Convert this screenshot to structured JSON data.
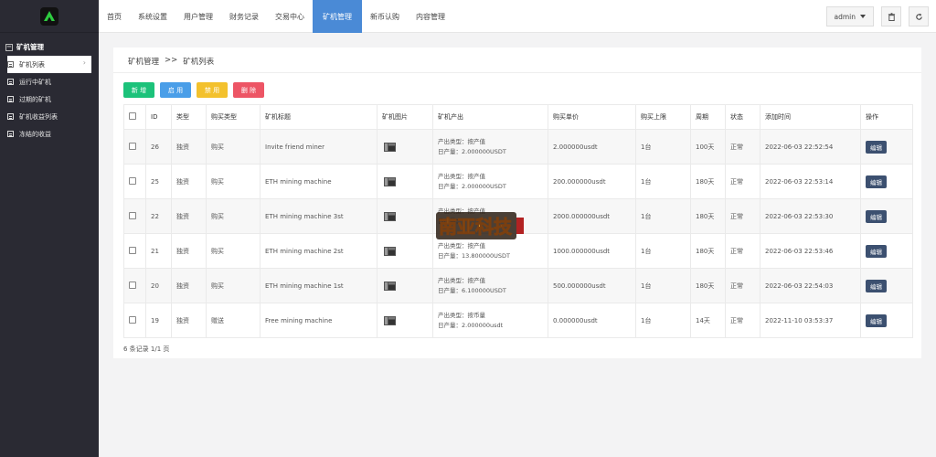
{
  "sidebar": {
    "group_label": "矿机管理",
    "items": [
      {
        "label": "矿机列表",
        "active": true
      },
      {
        "label": "运行中矿机"
      },
      {
        "label": "过期的矿机"
      },
      {
        "label": "矿机收益列表"
      },
      {
        "label": "冻结的收益"
      }
    ]
  },
  "topnav": {
    "items": [
      "首页",
      "系统设置",
      "用户管理",
      "财务记录",
      "交易中心",
      "矿机管理",
      "新币认购",
      "内容管理"
    ],
    "active_index": 5,
    "user": "admin"
  },
  "breadcrumb": {
    "parent": "矿机管理",
    "separator": ">>",
    "current": "矿机列表"
  },
  "toolbar": {
    "add": "新 增",
    "enable": "启 用",
    "disable": "禁 用",
    "delete": "删 除"
  },
  "table": {
    "headers": [
      "ID",
      "类型",
      "购买类型",
      "矿机标题",
      "矿机图片",
      "矿机产出",
      "购买单价",
      "购买上限",
      "周期",
      "状态",
      "添加时间",
      "操作"
    ],
    "rows": [
      {
        "id": "26",
        "type": "独资",
        "buy_type": "购买",
        "buy_color": "green",
        "title": "Invite friend miner",
        "out_type": "产出类型：按产值",
        "out_daily": "日产量：2.000000USDT",
        "price": "2.000000usdt",
        "limit": "1台",
        "cycle": "100天",
        "status": "正常",
        "time": "2022-06-03 22:52:54",
        "action": "编辑"
      },
      {
        "id": "25",
        "type": "独资",
        "buy_type": "购买",
        "buy_color": "green",
        "title": "ETH mining machine",
        "out_type": "产出类型：按产值",
        "out_daily": "日产量：2.000000USDT",
        "price": "200.000000usdt",
        "limit": "1台",
        "cycle": "180天",
        "status": "正常",
        "time": "2022-06-03 22:53:14",
        "action": "编辑"
      },
      {
        "id": "22",
        "type": "独资",
        "buy_type": "购买",
        "buy_color": "green",
        "title": "ETH mining machine 3st",
        "out_type": "产出类型：按产值",
        "out_daily": "日产量：",
        "price": "2000.000000usdt",
        "limit": "1台",
        "cycle": "180天",
        "status": "正常",
        "time": "2022-06-03 22:53:30",
        "action": "编辑"
      },
      {
        "id": "21",
        "type": "独资",
        "buy_type": "购买",
        "buy_color": "green",
        "title": "ETH mining machine 2st",
        "out_type": "产出类型：按产值",
        "out_daily": "日产量：13.800000USDT",
        "price": "1000.000000usdt",
        "limit": "1台",
        "cycle": "180天",
        "status": "正常",
        "time": "2022-06-03 22:53:46",
        "action": "编辑"
      },
      {
        "id": "20",
        "type": "独资",
        "buy_type": "购买",
        "buy_color": "green",
        "title": "ETH mining machine 1st",
        "out_type": "产出类型：按产值",
        "out_daily": "日产量：6.100000USDT",
        "price": "500.000000usdt",
        "limit": "1台",
        "cycle": "180天",
        "status": "正常",
        "time": "2022-06-03 22:54:03",
        "action": "编辑"
      },
      {
        "id": "19",
        "type": "独资",
        "buy_type": "赠送",
        "buy_color": "red",
        "title": "Free mining machine",
        "out_type": "产出类型：按币量",
        "out_daily": "日产量：2.000000usdt",
        "price": "0.000000usdt",
        "limit": "1台",
        "cycle": "14天",
        "status": "正常",
        "time": "2022-11-10 03:53:37",
        "action": "编辑"
      }
    ]
  },
  "footer": {
    "count": "6 条记录 1/1 页"
  },
  "watermark": {
    "text": "南亚科技"
  },
  "colors": {
    "sidebar": "#2a2a33",
    "nav_active": "#4a8ad6",
    "add": "#1cc27a",
    "enable": "#4a9ee8",
    "disable": "#f3c12d",
    "delete": "#ed5565",
    "edit": "#3c5070"
  },
  "icons": [
    "logo-icon",
    "trash-icon",
    "refresh-icon",
    "caret-down-icon",
    "doc-icon",
    "chevron-right-icon",
    "miner-image-icon"
  ]
}
